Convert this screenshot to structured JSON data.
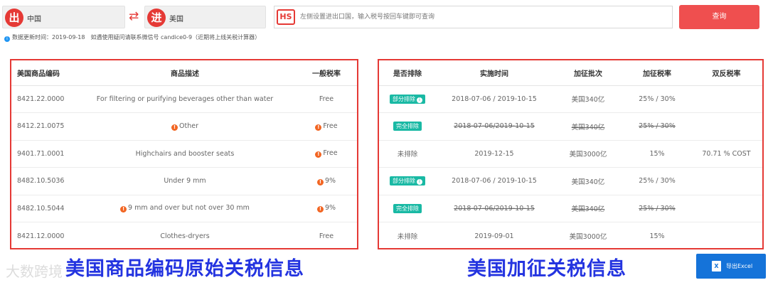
{
  "search": {
    "from_badge": "出",
    "from_country": "中国",
    "swap_icon": "⇄",
    "to_badge": "进",
    "to_country": "美国",
    "hs_logo": "HS",
    "placeholder": "左侧设置进出口国，输入税号按回车键即可查询",
    "query_label": "查询"
  },
  "info": {
    "text": "数据更新时间：2019-09-18　如遇使用疑问请联系微信号 candice0-9（近期将上线关税计算器）"
  },
  "left_table": {
    "headers": [
      "美国商品编码",
      "商品描述",
      "一般税率"
    ],
    "rows": [
      {
        "code": "8421.22.0000",
        "desc": "For filtering or purifying beverages other than water",
        "rate": "Free",
        "desc_warn": false,
        "rate_warn": false
      },
      {
        "code": "8412.21.0075",
        "desc": "Other",
        "rate": "Free",
        "desc_warn": true,
        "rate_warn": true
      },
      {
        "code": "9401.71.0001",
        "desc": "Highchairs and booster seats",
        "rate": "Free",
        "desc_warn": false,
        "rate_warn": true
      },
      {
        "code": "8482.10.5036",
        "desc": "Under 9 mm",
        "rate": "9%",
        "desc_warn": false,
        "rate_warn": true
      },
      {
        "code": "8482.10.5044",
        "desc": "9 mm and over but not over 30 mm",
        "rate": "9%",
        "desc_warn": true,
        "rate_warn": true
      },
      {
        "code": "8421.12.0000",
        "desc": "Clothes-dryers",
        "rate": "Free",
        "desc_warn": false,
        "rate_warn": false
      }
    ]
  },
  "right_table": {
    "headers": [
      "是否排除",
      "实施时间",
      "加征批次",
      "加征税率",
      "双反税率"
    ],
    "rows": [
      {
        "exclusion": "部分排除",
        "tag": true,
        "info_icon": true,
        "strike": false,
        "time": "2018-07-06 / 2019-10-15",
        "batch": "美国340亿",
        "rate": "25% / 30%",
        "ad": ""
      },
      {
        "exclusion": "完全排除",
        "tag": true,
        "info_icon": false,
        "strike": true,
        "time": "2018-07-06/2019-10-15",
        "batch": "美国340亿",
        "rate": "25% / 30%",
        "ad": ""
      },
      {
        "exclusion": "未排除",
        "tag": false,
        "info_icon": false,
        "strike": false,
        "time": "2019-12-15",
        "batch": "美国3000亿",
        "rate": "15%",
        "ad": "70.71 % COST"
      },
      {
        "exclusion": "部分排除",
        "tag": true,
        "info_icon": true,
        "strike": false,
        "time": "2018-07-06 / 2019-10-15",
        "batch": "美国340亿",
        "rate": "25% / 30%",
        "ad": ""
      },
      {
        "exclusion": "完全排除",
        "tag": true,
        "info_icon": false,
        "strike": true,
        "time": "2018-07-06/2019-10-15",
        "batch": "美国340亿",
        "rate": "25% / 30%",
        "ad": ""
      },
      {
        "exclusion": "未排除",
        "tag": false,
        "info_icon": false,
        "strike": false,
        "time": "2019-09-01",
        "batch": "美国3000亿",
        "rate": "15%",
        "ad": ""
      }
    ]
  },
  "captions": {
    "left": "美国商品编码原始关税信息",
    "right": "美国加征关税信息"
  },
  "watermark": "大数跨境",
  "export": {
    "label": "导出Excel"
  },
  "colors": {
    "accent_red": "#e53935",
    "query_button": "#ef4f4f",
    "tag_teal": "#19b9a4",
    "caption_blue": "#2434e0",
    "export_blue": "#1573d9",
    "warn_orange": "#f26522"
  }
}
